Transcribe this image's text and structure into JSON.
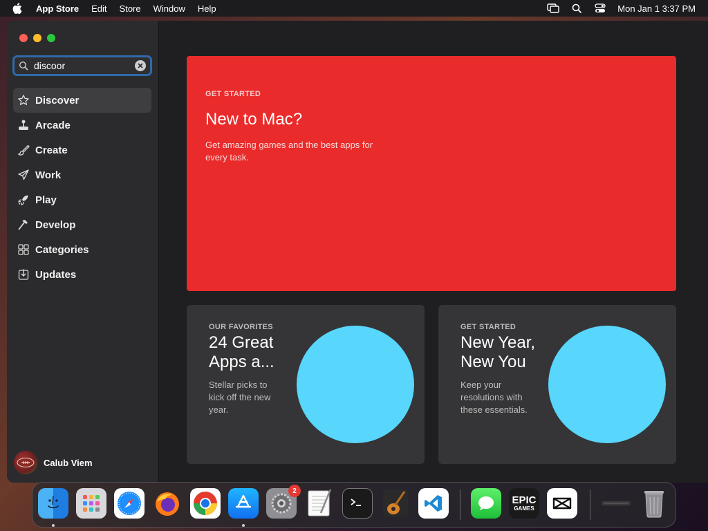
{
  "menubar": {
    "app_name": "App Store",
    "items": [
      "Edit",
      "Store",
      "Window",
      "Help"
    ],
    "clock": "Mon Jan 1  3:37 PM"
  },
  "sidebar": {
    "search": {
      "value": "discoor"
    },
    "items": [
      {
        "label": "Discover",
        "icon": "star-icon",
        "active": true
      },
      {
        "label": "Arcade",
        "icon": "joystick-icon"
      },
      {
        "label": "Create",
        "icon": "paintbrush-icon"
      },
      {
        "label": "Work",
        "icon": "paperplane-icon"
      },
      {
        "label": "Play",
        "icon": "rocket-icon"
      },
      {
        "label": "Develop",
        "icon": "hammer-icon"
      },
      {
        "label": "Categories",
        "icon": "grid-icon"
      },
      {
        "label": "Updates",
        "icon": "download-icon"
      }
    ],
    "user": {
      "name": "Calub Viem"
    }
  },
  "hero": {
    "eyebrow": "GET STARTED",
    "title": "New to Mac?",
    "description": "Get amazing games and the best apps for every task.",
    "color": "#ea2b2b"
  },
  "cards": [
    {
      "eyebrow": "OUR FAVORITES",
      "title": "24 Great Apps a...",
      "description": "Stellar picks to kick off the new year.",
      "accent": "#58d6fb"
    },
    {
      "eyebrow": "GET STARTED",
      "title": "New Year, New You",
      "description": "Keep your resolutions with these essentials.",
      "accent": "#58d6fb"
    }
  ],
  "dock": {
    "apps": [
      "Finder",
      "Launchpad",
      "Safari",
      "Firefox",
      "Chrome",
      "App Store",
      "System Settings",
      "TextEdit",
      "Terminal",
      "GarageBand",
      "Visual Studio Code",
      "Messages",
      "Epic Games",
      "CapCut",
      "Recent Item",
      "Trash"
    ],
    "settings_badge": "2",
    "epic_label_top": "EPIC",
    "epic_label_bottom": "GAMES"
  }
}
